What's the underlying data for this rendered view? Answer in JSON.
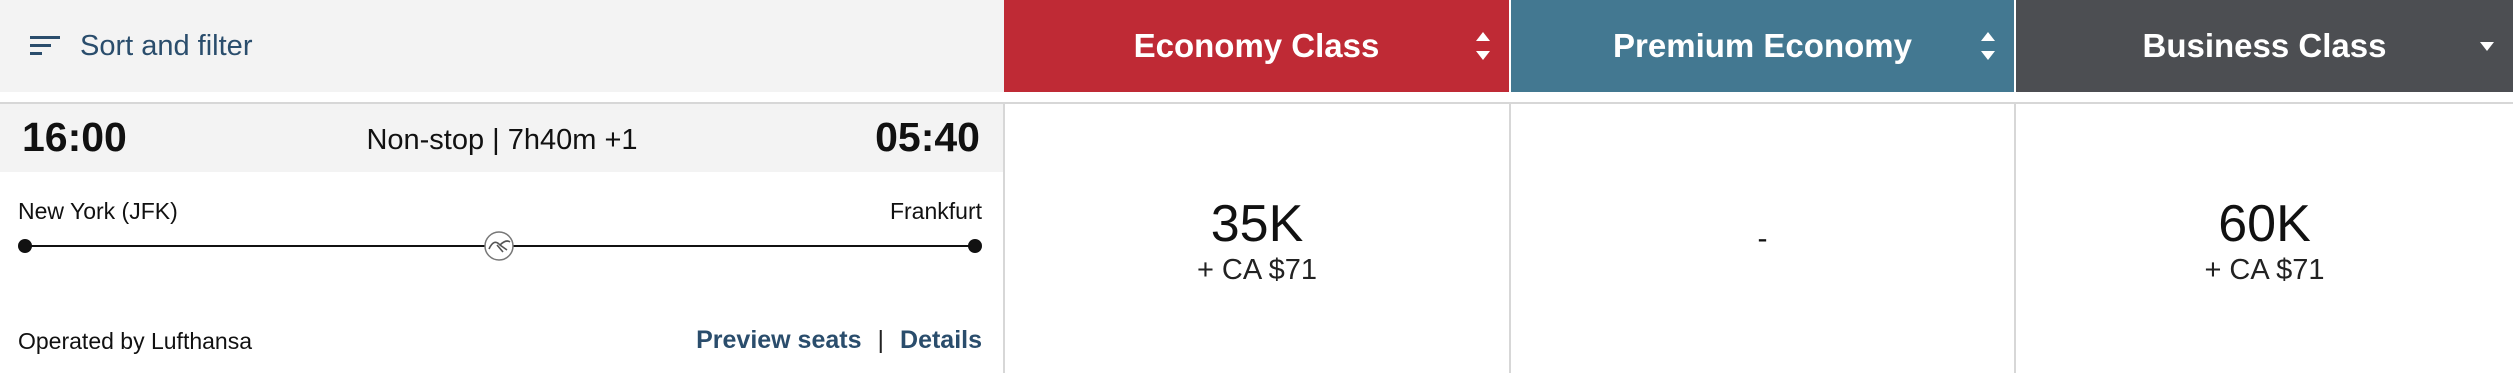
{
  "sort_filter": {
    "label": "Sort and filter",
    "icon": "sort-filter-icon"
  },
  "columns": [
    {
      "label": "Economy Class",
      "color": "#bf2a35",
      "icon": "sort-arrows-icon"
    },
    {
      "label": "Premium Economy",
      "color": "#437891",
      "icon": "sort-arrows-icon"
    },
    {
      "label": "Business Class",
      "color": "#4c4e52",
      "icon": "dropdown-arrow-icon"
    }
  ],
  "flight": {
    "departure_time": "16:00",
    "duration": "Non-stop | 7h40m +1",
    "arrival_time": "05:40",
    "origin": "New York (JFK)",
    "destination": "Frankfurt",
    "operator": "Operated by Lufthansa",
    "airline_icon": "lufthansa-crane-icon",
    "links": {
      "preview_seats": "Preview seats",
      "separator": "|",
      "details": "Details"
    }
  },
  "prices": {
    "economy": {
      "points": "35K",
      "cash": "+ CA $71"
    },
    "premium": {
      "value": "-"
    },
    "business": {
      "points": "60K",
      "cash": "+ CA $71"
    }
  }
}
